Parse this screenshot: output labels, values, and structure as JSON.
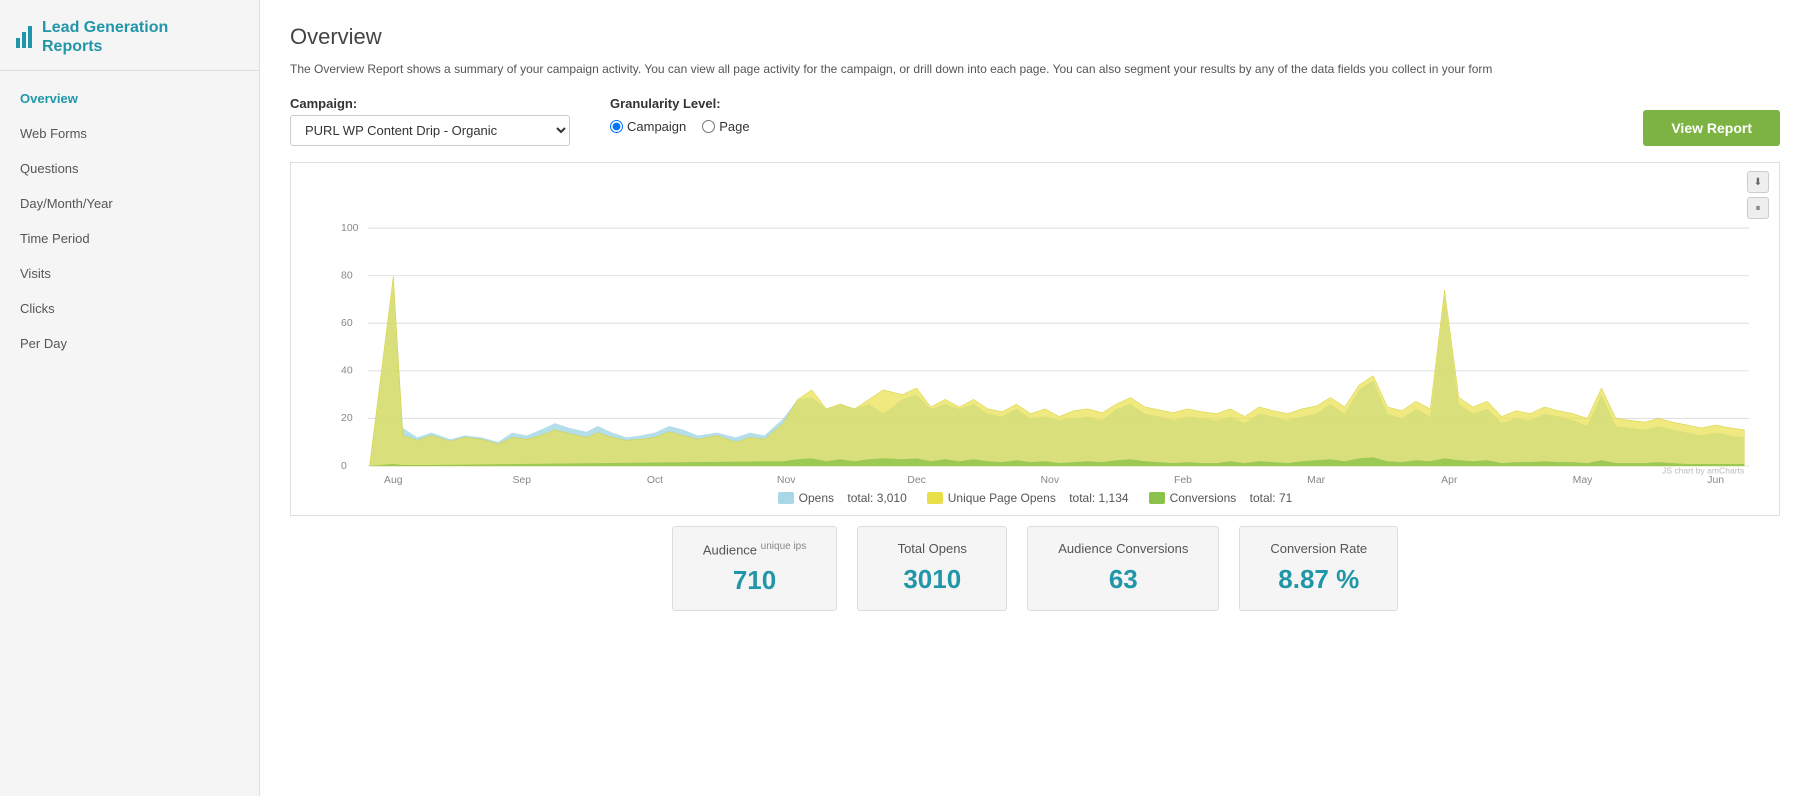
{
  "sidebar": {
    "logo_text": "Lead Generation\nReports",
    "nav_items": [
      {
        "label": "Overview",
        "active": true
      },
      {
        "label": "Web Forms",
        "active": false
      },
      {
        "label": "Questions",
        "active": false
      },
      {
        "label": "Day/Month/Year",
        "active": false
      },
      {
        "label": "Time Period",
        "active": false
      },
      {
        "label": "Visits",
        "active": false
      },
      {
        "label": "Clicks",
        "active": false
      },
      {
        "label": "Per Day",
        "active": false
      }
    ]
  },
  "main": {
    "title": "Overview",
    "description": "The Overview Report shows a summary of your campaign activity. You can view all page activity for the campaign, or drill down into each page. You can also segment your results by any of the data fields you collect in your form",
    "campaign_label": "Campaign:",
    "campaign_value": "PURL WP Content Drip - Organic",
    "granularity_label": "Granularity Level:",
    "granularity_options": [
      "Campaign",
      "Page"
    ],
    "granularity_selected": "Campaign",
    "view_report_label": "View Report",
    "chart": {
      "y_axis": [
        0,
        20,
        40,
        60,
        80,
        100
      ],
      "x_axis": [
        "Aug",
        "Sep",
        "Oct",
        "Nov",
        "Dec",
        "Nov",
        "Feb",
        "Mar",
        "Apr",
        "May",
        "Jun"
      ],
      "amcharts_credit": "JS chart by amCharts"
    },
    "legend": {
      "opens_label": "Opens",
      "opens_total": "total: 3,010",
      "unique_label": "Unique Page Opens",
      "unique_total": "total: 1,134",
      "conversions_label": "Conversions",
      "conversions_total": "total: 71"
    },
    "stats": [
      {
        "label": "Audience",
        "sublabel": "unique ips",
        "value": "710"
      },
      {
        "label": "Total Opens",
        "sublabel": "",
        "value": "3010"
      },
      {
        "label": "Audience Conversions",
        "sublabel": "",
        "value": "63"
      },
      {
        "label": "Conversion Rate",
        "sublabel": "",
        "value": "8.87 %"
      }
    ]
  }
}
